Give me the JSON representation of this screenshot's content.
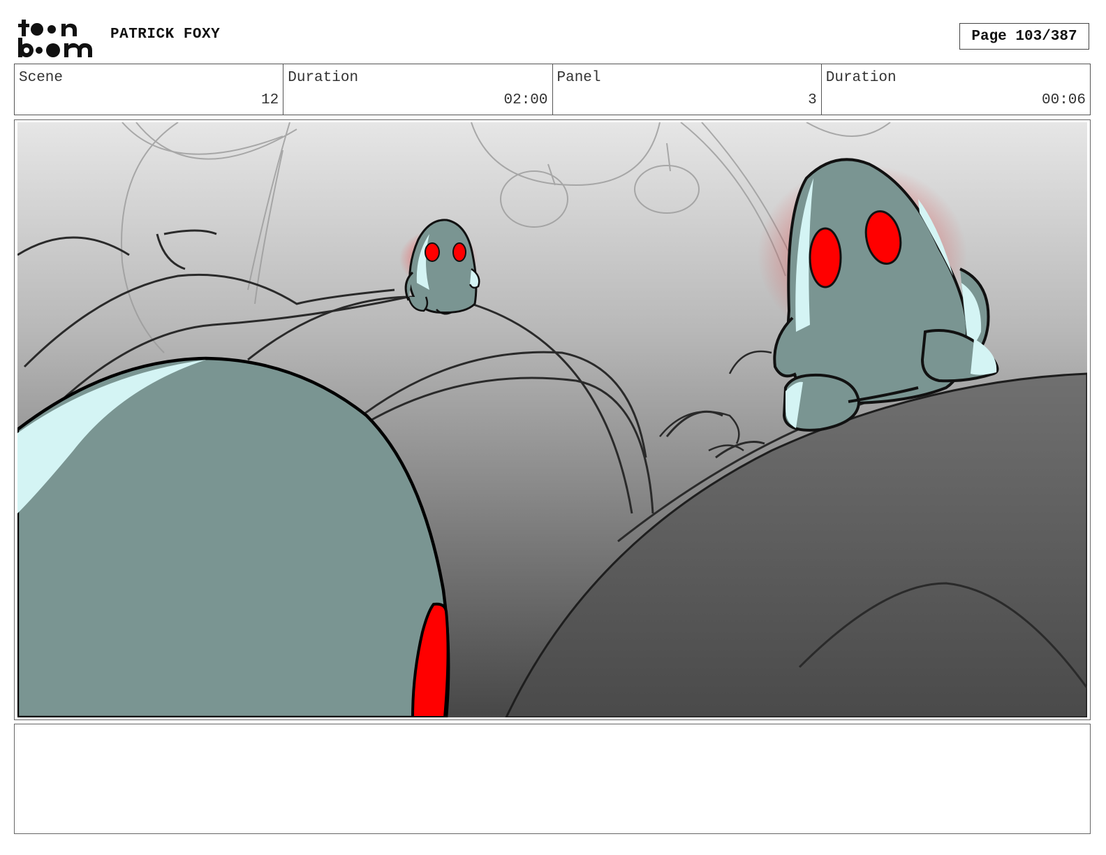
{
  "header": {
    "logo_text": "toonboom",
    "author": "PATRICK FOXY",
    "page": "Page 103/387"
  },
  "info": [
    {
      "label": "Scene",
      "value": "12"
    },
    {
      "label": "Duration",
      "value": "02:00"
    },
    {
      "label": "Panel",
      "value": "3"
    },
    {
      "label": "Duration",
      "value": "00:06"
    }
  ],
  "panel": {
    "colors": {
      "creature_body": "#7a9592",
      "creature_highlight": "#d4f4f4",
      "eye_red": "#ff0000",
      "glow_red": "#e03030",
      "sky_top": "#e6e6e6",
      "ground_dark": "#474747"
    }
  },
  "notes": {
    "text": ""
  }
}
